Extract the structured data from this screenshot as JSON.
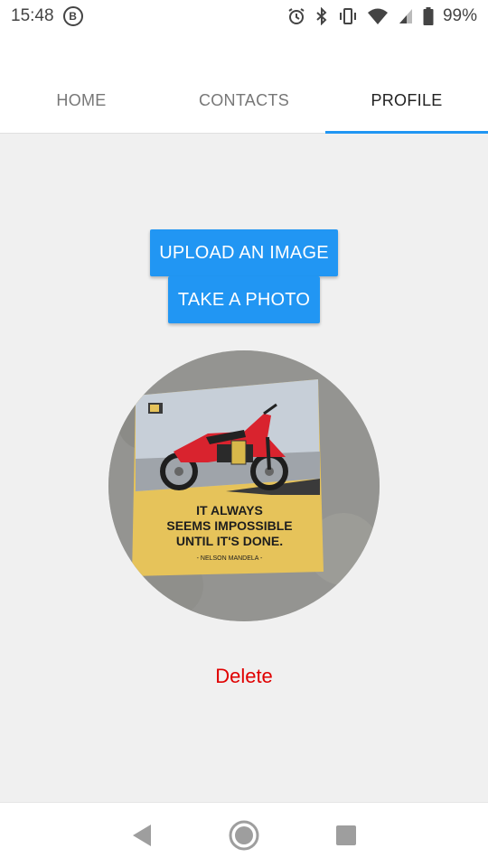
{
  "status_bar": {
    "time": "15:48",
    "notification_icon": "B",
    "battery_percent": "99%",
    "icons": [
      "alarm-icon",
      "bluetooth-icon",
      "vibrate-icon",
      "wifi-icon",
      "signal-icon",
      "battery-icon"
    ]
  },
  "tabs": [
    {
      "label": "HOME",
      "active": false
    },
    {
      "label": "CONTACTS",
      "active": false
    },
    {
      "label": "PROFILE",
      "active": true
    }
  ],
  "profile": {
    "upload_label": "UPLOAD AN IMAGE",
    "photo_label": "TAKE A PHOTO",
    "delete_label": "Delete",
    "avatar": {
      "poster_quote_line1": "IT ALWAYS",
      "poster_quote_line2": "SEEMS IMPOSSIBLE",
      "poster_quote_line3": "UNTIL IT'S DONE.",
      "poster_author": "- NELSON MANDELA -"
    }
  },
  "colors": {
    "accent": "#2196f3",
    "delete": "#e00000",
    "background": "#f0f0f0"
  },
  "nav_bar": {
    "icons": [
      "back-icon",
      "home-icon",
      "recents-icon"
    ]
  }
}
